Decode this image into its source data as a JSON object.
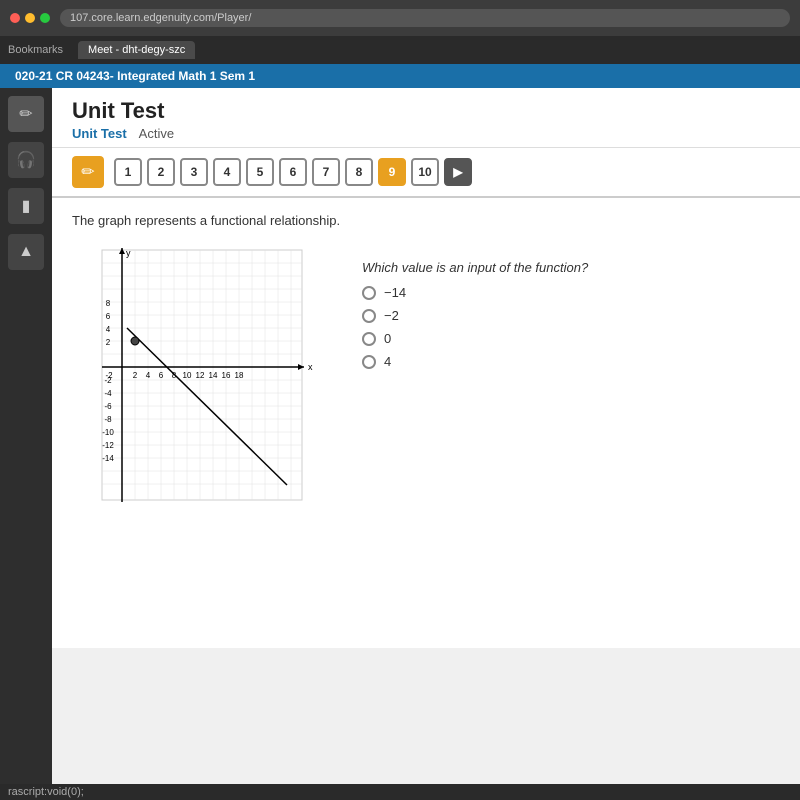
{
  "browser": {
    "url": "107.core.learn.edgenuity.com/Player/"
  },
  "tabs": [
    {
      "label": "Bookmarks",
      "active": false
    },
    {
      "label": "Meet - dht-degy-szc",
      "active": true
    }
  ],
  "course": {
    "banner": "020-21 CR 04243- Integrated Math 1 Sem 1"
  },
  "unit": {
    "title": "Unit Test",
    "subtitle": "Unit Test",
    "status": "Active"
  },
  "navigation": {
    "questions": [
      1,
      2,
      3,
      4,
      5,
      6,
      7,
      8,
      9,
      10
    ],
    "current": 9,
    "pencil_icon": "✏"
  },
  "question": {
    "text": "The graph represents a functional relationship.",
    "answer_label": "Which value is an input of the function?",
    "choices": [
      {
        "value": "-14",
        "label": "-14"
      },
      {
        "value": "-2",
        "label": "-2"
      },
      {
        "value": "0",
        "label": "0"
      },
      {
        "value": "4",
        "label": "4"
      }
    ]
  },
  "sidebar": {
    "icons": [
      {
        "name": "pencil",
        "symbol": "✏",
        "active": true
      },
      {
        "name": "headphone",
        "symbol": "🎧",
        "active": false
      },
      {
        "name": "calculator",
        "symbol": "▦",
        "active": false
      },
      {
        "name": "up-arrow",
        "symbol": "▲",
        "active": false
      }
    ]
  },
  "status_bar": {
    "text": "rascript:void(0);"
  }
}
